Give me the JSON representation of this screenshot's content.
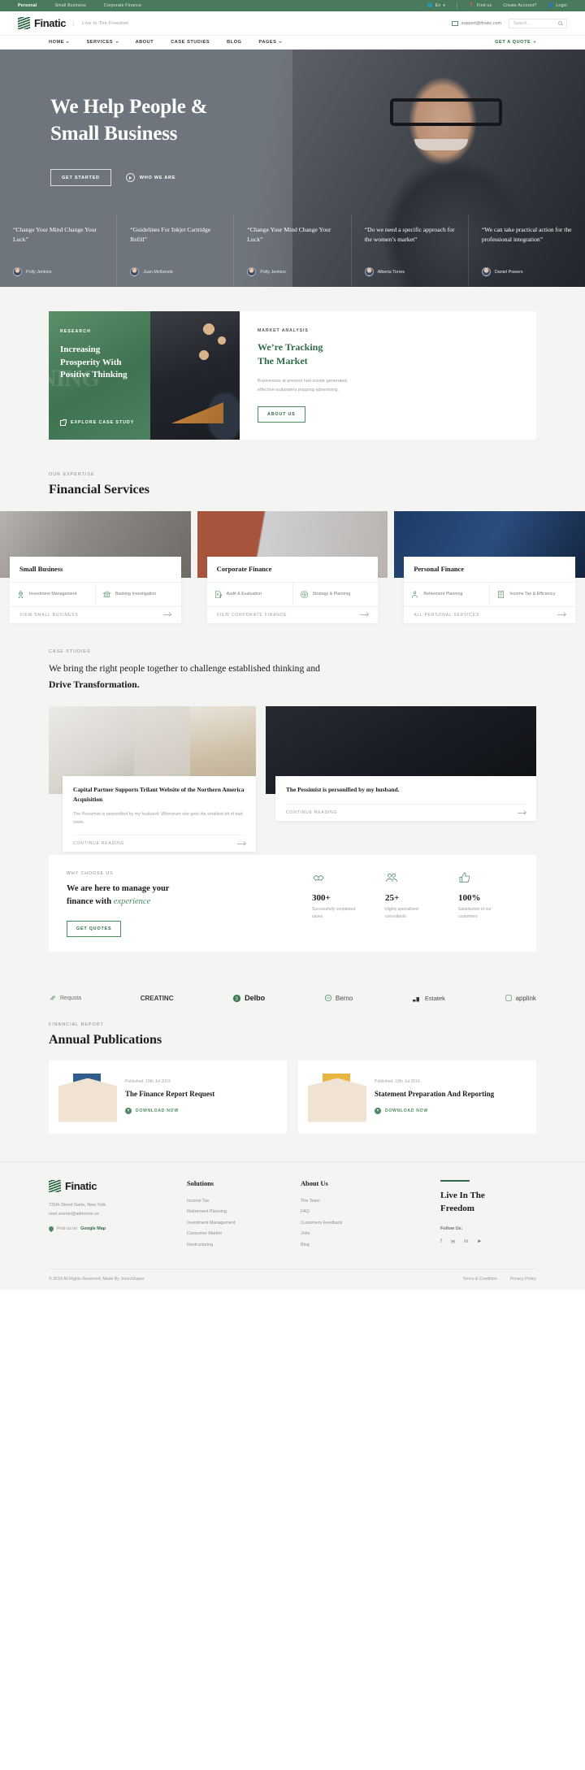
{
  "topbar": {
    "links": [
      "Personal",
      "Small Business",
      "Corporate Finance"
    ],
    "active": "Personal",
    "lang": "En",
    "find_us": "Find us",
    "create_account": "Create Account?",
    "login": "Login"
  },
  "header": {
    "brand": "Finatic",
    "tagline": "Live In The Freedom",
    "email": "support@finatic.com",
    "search_placeholder": "Search..."
  },
  "nav": {
    "items": [
      {
        "label": "HOME",
        "caret": true
      },
      {
        "label": "SERVICES",
        "caret": true
      },
      {
        "label": "ABOUT",
        "caret": false
      },
      {
        "label": "CASE STUDIES",
        "caret": false
      },
      {
        "label": "BLOG",
        "caret": false
      },
      {
        "label": "PAGES",
        "caret": true
      }
    ],
    "cta": "GET A QUOTE"
  },
  "hero": {
    "title_line1": "We Help People &",
    "title_line2": "Small Business",
    "cta": "GET STARTED",
    "video_label": "WHO WE ARE",
    "testimonials": [
      {
        "quote": "“Change Your Mind Change Your Luck”",
        "name": "Polly Jenkins"
      },
      {
        "quote": "“Guidelines For Inkjet Cartridge Refill”",
        "name": "Juan McKenzie"
      },
      {
        "quote": "“Change Your Mind Change Your Luck”",
        "name": "Polly Jenkins"
      },
      {
        "quote": "“Do we need a specific approach for the women’s market”",
        "name": "Alberta Torres"
      },
      {
        "quote": "“We can take practical action for the professional integration”",
        "name": "Daniel Powers"
      }
    ]
  },
  "promo": {
    "research": {
      "kicker": "RESEARCH",
      "title": "Increasing Prosperity With Positive Thinking",
      "link": "EXPLORE CASE STUDY"
    },
    "analysis": {
      "kicker": "MARKET ANALYSIS",
      "title_line1": "We’re Tracking",
      "title_line2": "The Market",
      "body": "Businesses at present had create generated effective outlanders popping advertising.",
      "cta": "ABOUT US"
    }
  },
  "services": {
    "kicker": "OUR EXPERTISE",
    "title": "Financial Services",
    "cards": [
      {
        "title": "Small Business",
        "features": [
          {
            "icon": "rocket-icon",
            "label": "Investment Management"
          },
          {
            "icon": "bank-icon",
            "label": "Banking Investigation"
          }
        ],
        "link": "VIEW SMALL BUSINESS"
      },
      {
        "title": "Corporate Finance",
        "features": [
          {
            "icon": "document-edit-icon",
            "label": "Audit & Evaluation"
          },
          {
            "icon": "strategy-icon",
            "label": "Strategy & Planning"
          }
        ],
        "link": "VIEW CORPORATE FINANCE"
      },
      {
        "title": "Personal Finance",
        "features": [
          {
            "icon": "retirement-icon",
            "label": "Retirement Planning"
          },
          {
            "icon": "tax-icon",
            "label": "Income Tax & Efficiency"
          }
        ],
        "link": "ALL PERSONAL SERVICES"
      }
    ]
  },
  "cases": {
    "kicker": "CASE STUDIES",
    "heading_a": "We bring the right people together to challenge established",
    "heading_b": "thinking and ",
    "heading_bold": "Drive Transformation.",
    "primary": {
      "title": "Capital Partner Supports Trilant Website of the Northern America Acquisition",
      "body": "The Pessimist is personified by my husband. Whenever she gets the smallest bit of bad news.",
      "link": "CONTINUE READING"
    },
    "secondary": {
      "title": "The Pessimist is personified by my husband.",
      "link": "CONTINUE READING"
    }
  },
  "why": {
    "kicker": "WHY CHOOSE US",
    "title_a": "We are here to manage your",
    "title_b": "finance with ",
    "title_em": "experience",
    "cta": "GET QUOTES",
    "stats": [
      {
        "icon": "handshake-icon",
        "value": "300+",
        "label": "Successfully completed cases"
      },
      {
        "icon": "team-icon",
        "value": "25+",
        "label": "Highly specialised consultants"
      },
      {
        "icon": "thumbsup-icon",
        "value": "100%",
        "label": "Satisfaction of our customers"
      }
    ]
  },
  "brands": [
    {
      "name": "Requsta",
      "icon": "requsta-icon"
    },
    {
      "name": "CREATINC",
      "icon": "creatinc-icon"
    },
    {
      "name": "Delbo",
      "icon": "delbo-icon"
    },
    {
      "name": "Berno",
      "icon": "berno-icon"
    },
    {
      "name": "Estatek",
      "icon": "estatek-icon"
    },
    {
      "name": "applink",
      "icon": "applink-icon"
    }
  ],
  "publications": {
    "kicker": "FINANCIAL REPORT",
    "title": "Annual Publications",
    "items": [
      {
        "meta": "Published: 18th Jul 2019",
        "title": "The Finance Report Request",
        "cta": "DOWNLOAD NOW"
      },
      {
        "meta": "Published: 18th Jul 2019",
        "title": "Statement Preparation And Reporting",
        "cta": "DOWNLOAD NOW"
      }
    ]
  },
  "footer": {
    "brand": "Finatic",
    "address_line1": "731th Street Garte, New York",
    "address_line2": "noel.cremin@adrienne.us",
    "map_prefix": "Find us on ",
    "map_link": "Google Map",
    "columns": [
      {
        "title": "Solutions",
        "items": [
          "Income Tax",
          "Retirement Planning",
          "Investment Management",
          "Consumer Market",
          "Restructuring"
        ]
      },
      {
        "title": "About Us",
        "items": [
          "The Team",
          "FAQ",
          "Customers Feedback",
          "Jobs",
          "Blog"
        ]
      }
    ],
    "cta_line1": "Live In The",
    "cta_line2": "Freedom",
    "follow": "Follow Us:",
    "socials": [
      "facebook-icon",
      "twitter-icon",
      "linkedin-icon",
      "youtube-icon"
    ],
    "copyright": "© 2019 All Rights Reserved. Made By JoomShaper",
    "legal": [
      "Terms & Condition",
      "Privacy Policy"
    ]
  },
  "colors": {
    "brand_green": "#2f6b45",
    "accent_green": "#4e8a63",
    "topbar_green": "#4a7a5c",
    "page_bg": "#f4f4f2"
  }
}
